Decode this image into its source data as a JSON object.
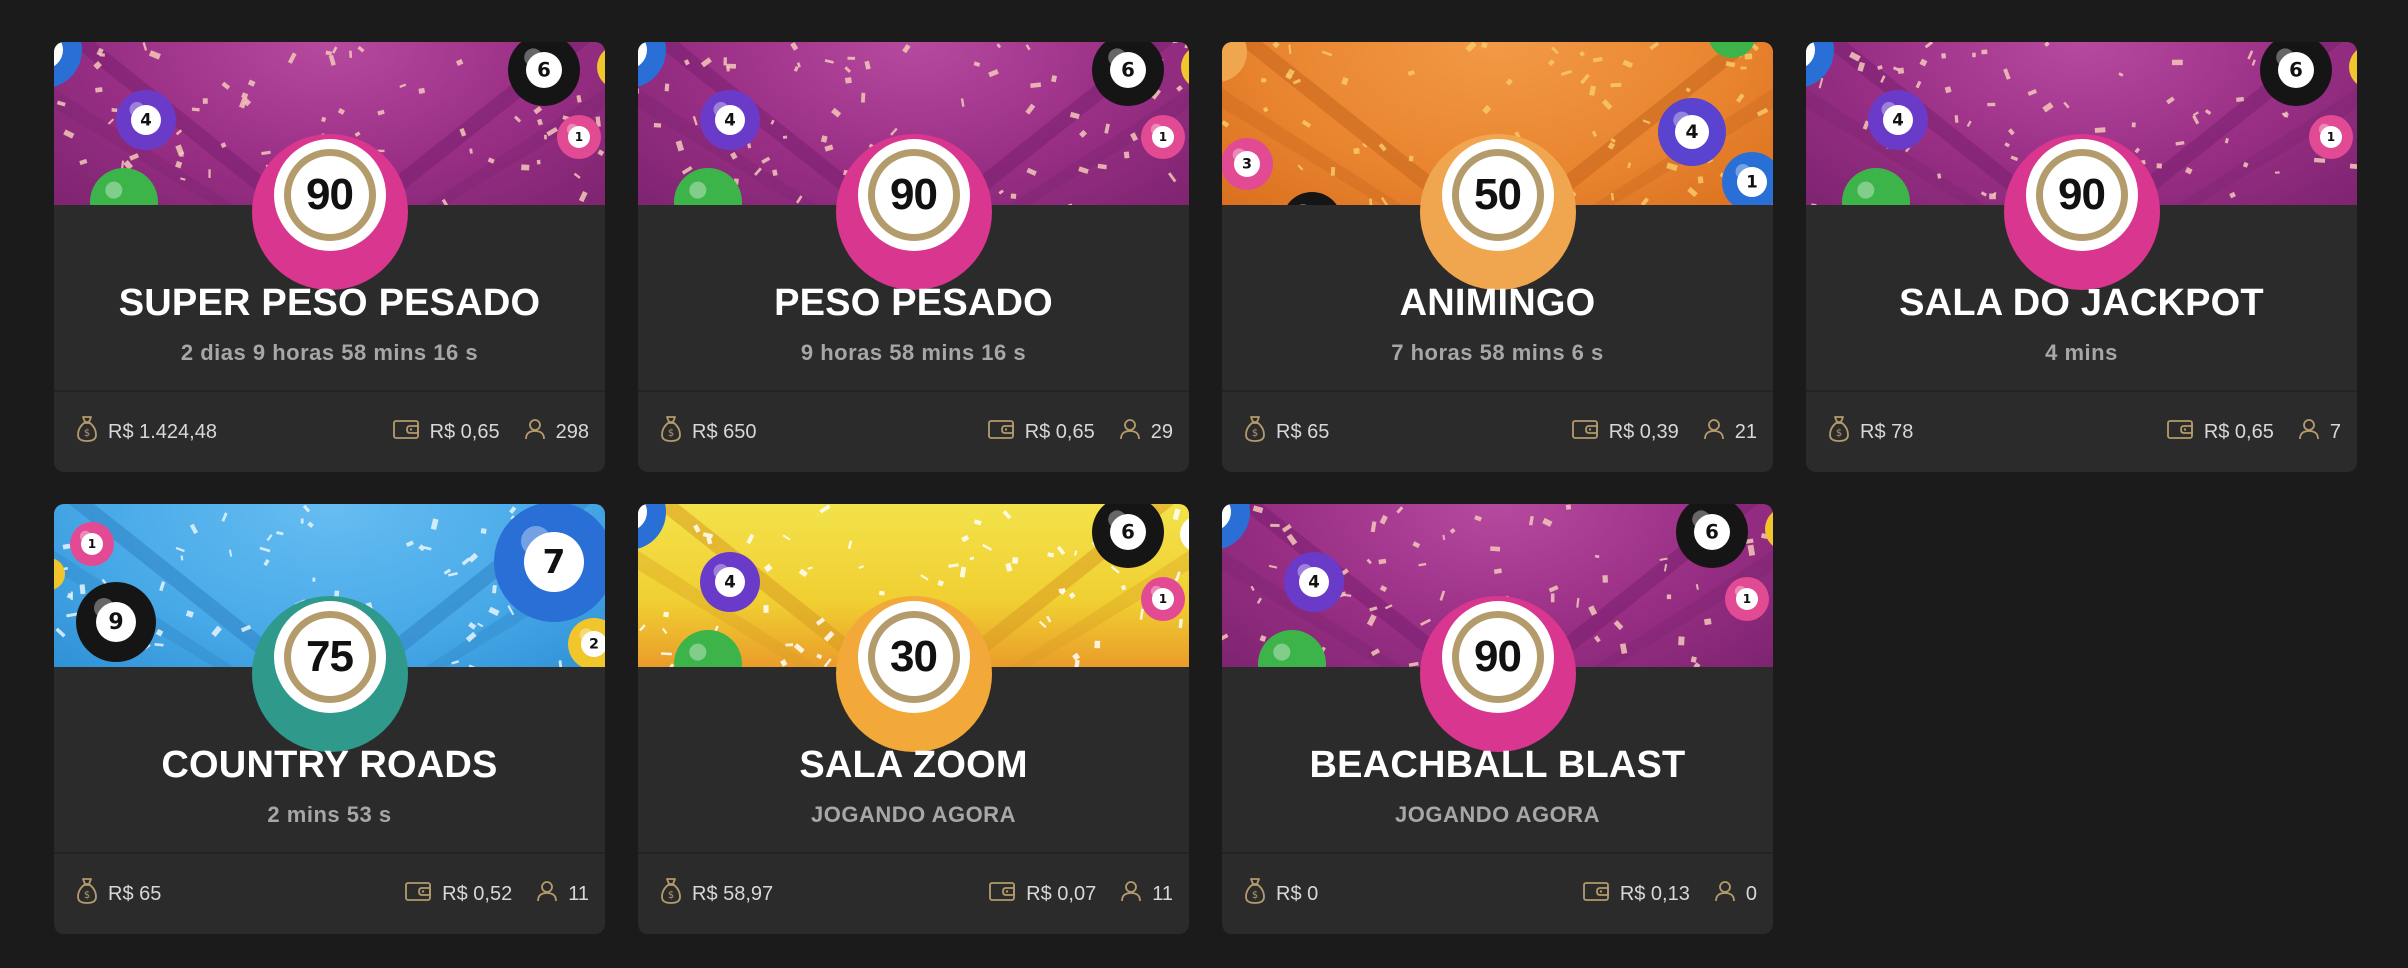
{
  "colors": {
    "background": "#1b1b1c",
    "card": "#2b2b2c",
    "gold": "#b49b6c",
    "title": "#ffffff",
    "subtitle": "#a7a7a7"
  },
  "icons": {
    "prize": "money-bag-icon",
    "card_price": "wallet-icon",
    "players": "user-icon"
  },
  "rooms": [
    {
      "theme": "pink",
      "balls": "90",
      "name": "SUPER PESO PESADO",
      "status": "2 dias 9 horas 58 mins 16 s",
      "prize": "R$ 1.424,48",
      "price": "R$ 0,65",
      "players": "298"
    },
    {
      "theme": "pink",
      "balls": "90",
      "name": "PESO PESADO",
      "status": "9 horas 58 mins 16 s",
      "prize": "R$ 650",
      "price": "R$ 0,65",
      "players": "29"
    },
    {
      "theme": "orange",
      "balls": "50",
      "name": "ANIMINGO",
      "status": "7 horas 58 mins 6 s",
      "prize": "R$ 65",
      "price": "R$ 0,39",
      "players": "21"
    },
    {
      "theme": "pink",
      "balls": "90",
      "name": "SALA DO JACKPOT",
      "status": "4 mins",
      "prize": "R$ 78",
      "price": "R$ 0,65",
      "players": "7"
    },
    {
      "theme": "blue",
      "balls": "75",
      "name": "COUNTRY ROADS",
      "status": "2 mins 53 s",
      "prize": "R$ 65",
      "price": "R$ 0,52",
      "players": "11"
    },
    {
      "theme": "yellow",
      "balls": "30",
      "name": "SALA ZOOM",
      "status": "JOGANDO AGORA",
      "prize": "R$ 58,97",
      "price": "R$ 0,07",
      "players": "11"
    },
    {
      "theme": "pink",
      "balls": "90",
      "name": "BEACHBALL BLAST",
      "status": "JOGANDO AGORA",
      "prize": "R$ 0",
      "price": "R$ 0,13",
      "players": "0"
    }
  ]
}
